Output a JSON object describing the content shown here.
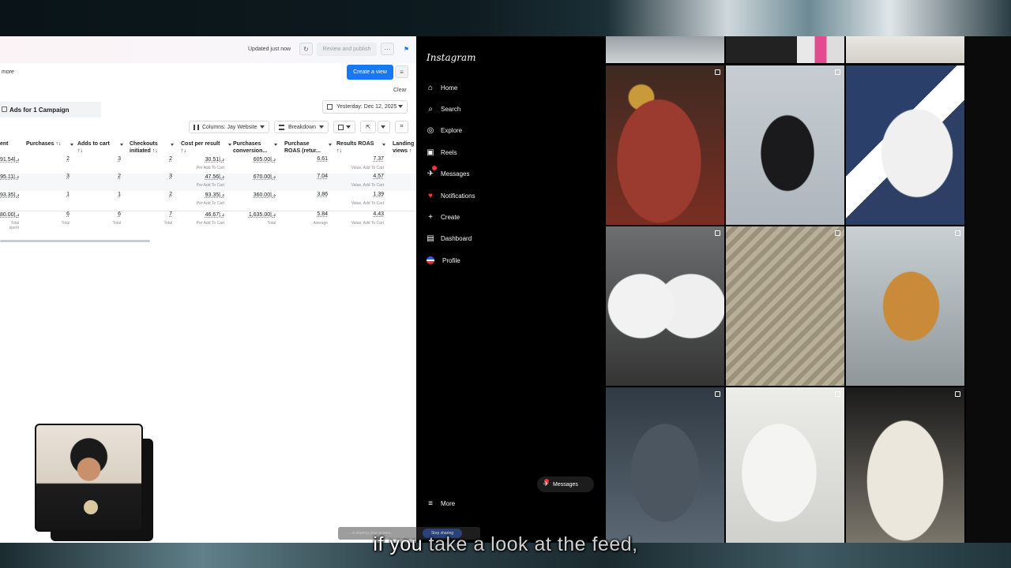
{
  "ads_manager": {
    "status": "Updated just now",
    "review_label": "Review and publish",
    "more_link": "more",
    "create_view_label": "Create a view",
    "clear_label": "Clear",
    "campaign_tab": "Ads for 1 Campaign",
    "date_range": "Yesterday: Dec 12, 2025",
    "columns_label": "Columns: Jay Website",
    "breakdown_label": "Breakdown",
    "headers": [
      "ent",
      "Purchases ↑↓",
      "Adds to cart ↑↓",
      "Checkouts initiated ↑↓",
      "Cost per result ↑↓",
      "Purchases conversion...",
      "Purchase ROAS (retur...",
      "Results ROAS ↑↓",
      "Landing views ↑"
    ],
    "rows": [
      {
        "spent": "91.54|.د",
        "purchases": "2",
        "adds": "3",
        "checkouts": "2",
        "cpr": "30.51|.د",
        "cpr_sub": "Per Add To Cart",
        "conv": "605.00|.د",
        "roas": "6.61",
        "results_roas": "7.37",
        "rr_sub": "Value, Add To Cart"
      },
      {
        "spent": "95.11|.د",
        "purchases": "3",
        "adds": "2",
        "checkouts": "3",
        "cpr": "47.56|.د",
        "cpr_sub": "Per Add To Cart",
        "conv": "670.00|.د",
        "roas": "7.04",
        "results_roas": "4.57",
        "rr_sub": "Value, Add To Cart"
      },
      {
        "spent": "93.35|.د",
        "purchases": "1",
        "adds": "1",
        "checkouts": "2",
        "cpr": "93.35|.د",
        "cpr_sub": "Per Add To Cart",
        "conv": "360.00|.د",
        "roas": "3.86",
        "results_roas": "1.39",
        "rr_sub": "Value, Add To Cart"
      }
    ],
    "total": {
      "spent": "80.00|.د",
      "spent_sub": "Total spent",
      "purchases": "6",
      "purchases_sub": "Total",
      "adds": "6",
      "adds_sub": "Total",
      "checkouts": "7",
      "checkouts_sub": "Total",
      "cpr": "46.67|.د",
      "cpr_sub": "Per Add To Cart",
      "conv": "1,635.00|.د",
      "conv_sub": "Total",
      "roas": "5.84",
      "roas_sub": "Average",
      "results_roas": "4.43",
      "rr_sub": "Value, Add To Cart"
    }
  },
  "instagram": {
    "logo": "Instagram",
    "nav": [
      {
        "label": "Home",
        "icon": "home-icon",
        "glyph": "⌂"
      },
      {
        "label": "Search",
        "icon": "search-icon",
        "glyph": "⌕"
      },
      {
        "label": "Explore",
        "icon": "compass-icon",
        "glyph": "◎"
      },
      {
        "label": "Reels",
        "icon": "reels-icon",
        "glyph": "▣"
      },
      {
        "label": "Messages",
        "icon": "messages-icon",
        "glyph": "✈"
      },
      {
        "label": "Notifications",
        "icon": "heart-icon",
        "glyph": "♥"
      },
      {
        "label": "Create",
        "icon": "plus-icon",
        "glyph": "+"
      },
      {
        "label": "Dashboard",
        "icon": "dashboard-icon",
        "glyph": "▤"
      },
      {
        "label": "Profile",
        "icon": "profile-avatar",
        "glyph": ""
      }
    ],
    "more_label": "More",
    "messages_pill": "Messages"
  },
  "caption": {
    "highlight": "if you",
    "rest": " take a look at the feed,"
  },
  "screen_share": {
    "notice": "... is sharing your screen.",
    "stop": "Stop sharing"
  },
  "colors": {
    "accent": "#1877f2",
    "notify": "#ff3040",
    "ig_bg": "#000000"
  }
}
